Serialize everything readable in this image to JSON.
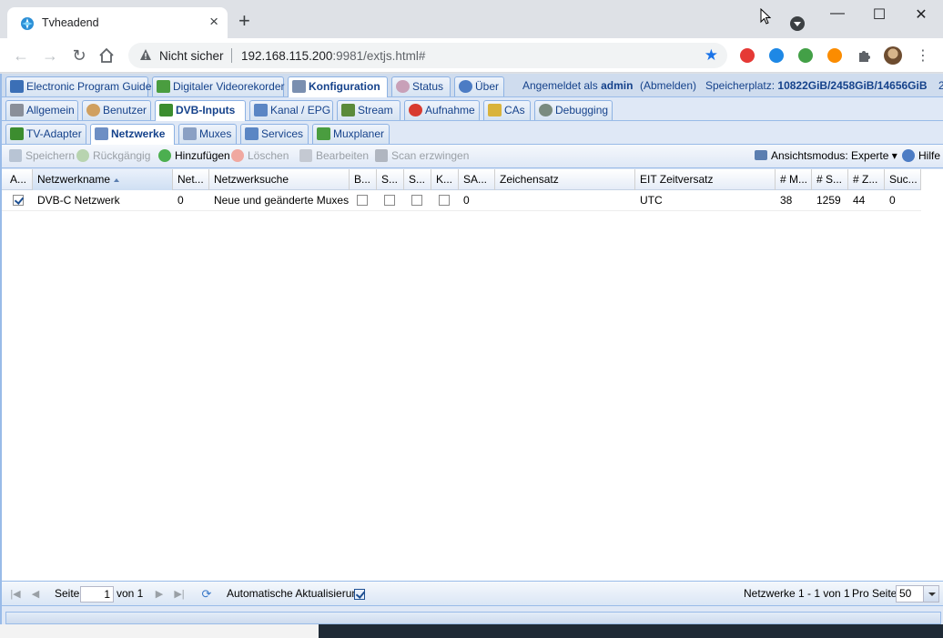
{
  "browser": {
    "tab_title": "Tvheadend",
    "tab_close": "×",
    "new_tab": "+",
    "security_label": "Nicht sicher",
    "url_host": "192.168.115.200",
    "url_rest": ":9981/extjs.html#",
    "window_controls": [
      "—",
      "☐",
      "✕"
    ]
  },
  "top_tabs": [
    {
      "label": "Electronic Program Guide",
      "active": false
    },
    {
      "label": "Digitaler Videorekorder",
      "active": false
    },
    {
      "label": "Konfiguration",
      "active": true
    },
    {
      "label": "Status",
      "active": false
    },
    {
      "label": "Über",
      "active": false
    }
  ],
  "session": {
    "logged_in_prefix": "Angemeldet als",
    "user": "admin",
    "logout": "(Abmelden)",
    "storage_prefix": "Speicherplatz:",
    "storage_value": "10822GiB/2458GiB/14656GiB",
    "overflow": "2"
  },
  "config_tabs": [
    {
      "label": "Allgemein"
    },
    {
      "label": "Benutzer"
    },
    {
      "label": "DVB-Inputs"
    },
    {
      "label": "Kanal / EPG"
    },
    {
      "label": "Stream"
    },
    {
      "label": "Aufnahme"
    },
    {
      "label": "CAs"
    },
    {
      "label": "Debugging"
    }
  ],
  "dvb_tabs": [
    {
      "label": "TV-Adapter"
    },
    {
      "label": "Netzwerke"
    },
    {
      "label": "Muxes"
    },
    {
      "label": "Services"
    },
    {
      "label": "Muxplaner"
    }
  ],
  "toolbar": {
    "save": "Speichern",
    "undo": "Rückgängig",
    "add": "Hinzufügen",
    "delete": "Löschen",
    "edit": "Bearbeiten",
    "scan": "Scan erzwingen",
    "view_mode": "Ansichtsmodus: Experte",
    "help": "Hilfe"
  },
  "grid": {
    "columns": [
      "A...",
      "Netzwerkname",
      "Net...",
      "Netzwerksuche",
      "B...",
      "S...",
      "S...",
      "K...",
      "SA...",
      "Zeichensatz",
      "EIT Zeitversatz",
      "# M...",
      "# S...",
      "# Z...",
      "Suc..."
    ],
    "rows": [
      {
        "enabled": true,
        "name": "DVB-C Netzwerk",
        "net": "0",
        "discovery": "Neue und geänderte Muxes",
        "b": false,
        "s1": false,
        "s2": false,
        "k": false,
        "sa": "0",
        "charset": "",
        "eit": "UTC",
        "muxes": "38",
        "services": "1259",
        "channels": "44",
        "success": "0"
      }
    ]
  },
  "paging": {
    "page_label": "Seite",
    "page_value": "1",
    "of_label": "von 1",
    "auto_refresh": "Automatische Aktualisierung",
    "auto_refresh_on": true,
    "summary": "Netzwerke 1 - 1 von 1",
    "per_page_label": "Pro Seite",
    "per_page": "50"
  }
}
